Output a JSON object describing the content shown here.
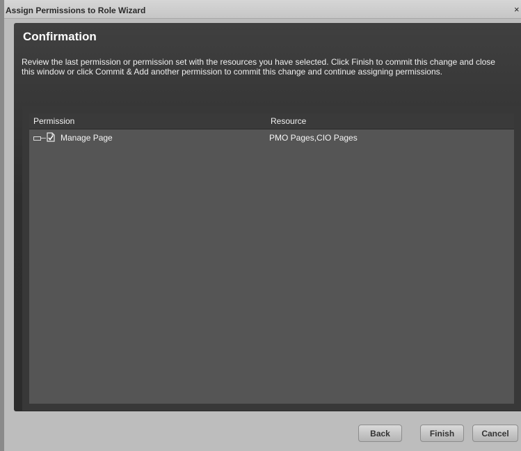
{
  "window": {
    "title": "Assign Permissions to Role Wizard",
    "close_label": "×"
  },
  "content": {
    "heading": "Confirmation",
    "description": "Review the last permission or permission set with the resources you have selected. Click Finish to commit this change and close this window or click Commit & Add another permission to commit this change and continue assigning permissions."
  },
  "table": {
    "columns": [
      "Permission",
      "Resource"
    ],
    "rows": [
      {
        "permission": "Manage Page",
        "resource": "PMO Pages,CIO Pages",
        "icon": "page-check-icon",
        "expander": "collapse"
      }
    ]
  },
  "buttons": {
    "back": "Back",
    "finish": "Finish",
    "cancel": "Cancel"
  }
}
